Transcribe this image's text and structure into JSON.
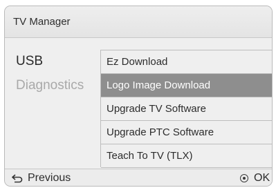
{
  "window": {
    "title": "TV Manager"
  },
  "categories": [
    {
      "label": "USB",
      "active": true
    },
    {
      "label": "Diagnostics",
      "active": false
    }
  ],
  "menu": {
    "items": [
      {
        "label": "Ez Download",
        "selected": false
      },
      {
        "label": "Logo Image Download",
        "selected": true
      },
      {
        "label": "Upgrade TV Software",
        "selected": false
      },
      {
        "label": "Upgrade PTC Software",
        "selected": false
      },
      {
        "label": "Teach To TV (TLX)",
        "selected": false
      }
    ]
  },
  "footer": {
    "previous_label": "Previous",
    "previous_icon": "back-arrow-icon",
    "ok_label": "OK",
    "ok_icon": "ok-button-icon"
  },
  "colors": {
    "selected_bg": "#8e8e8e",
    "inactive_text": "#a9a9a9"
  }
}
